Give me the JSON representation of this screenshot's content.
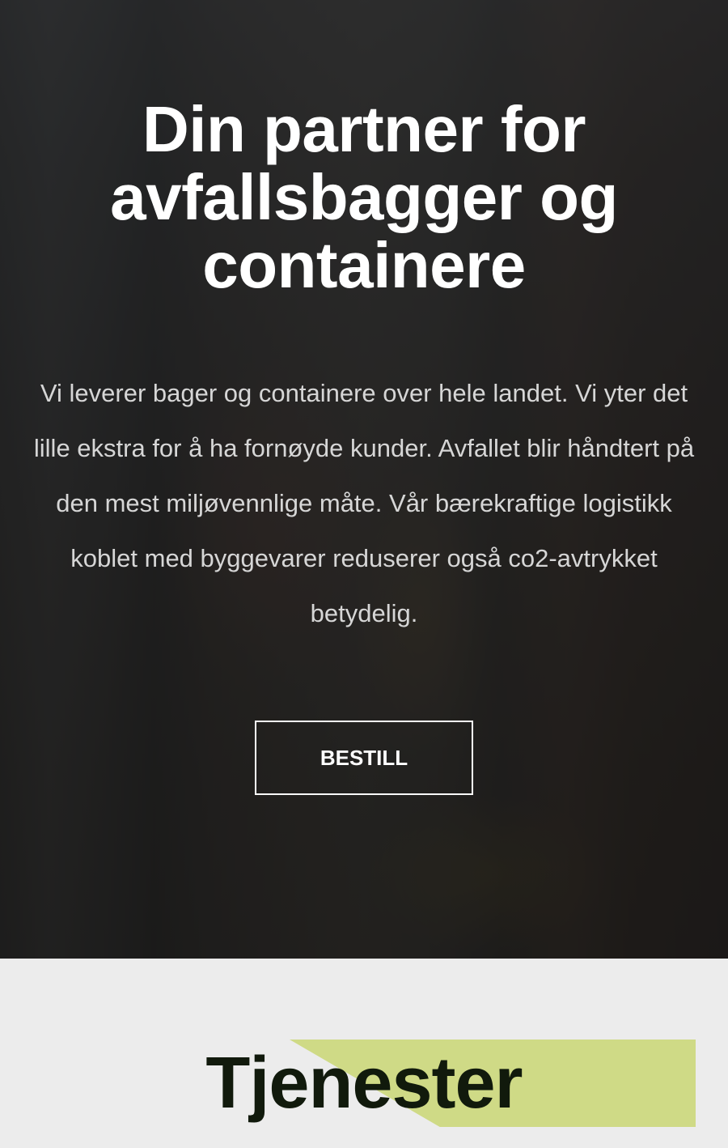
{
  "hero": {
    "title": "Din partner for avfallsbagger og containere",
    "text": "Vi leverer bager og containere over hele landet. Vi yter det lille ekstra for å ha fornøyde kunder. Avfallet blir håndtert på den mest miljøvennlige måte. Vår bærekraftige logistikk koblet med byggevarer reduserer også co2-avtrykket betydelig.",
    "button_label": "BESTILL"
  },
  "services": {
    "title": "Tjenester",
    "accent_color": "#cfda86"
  }
}
